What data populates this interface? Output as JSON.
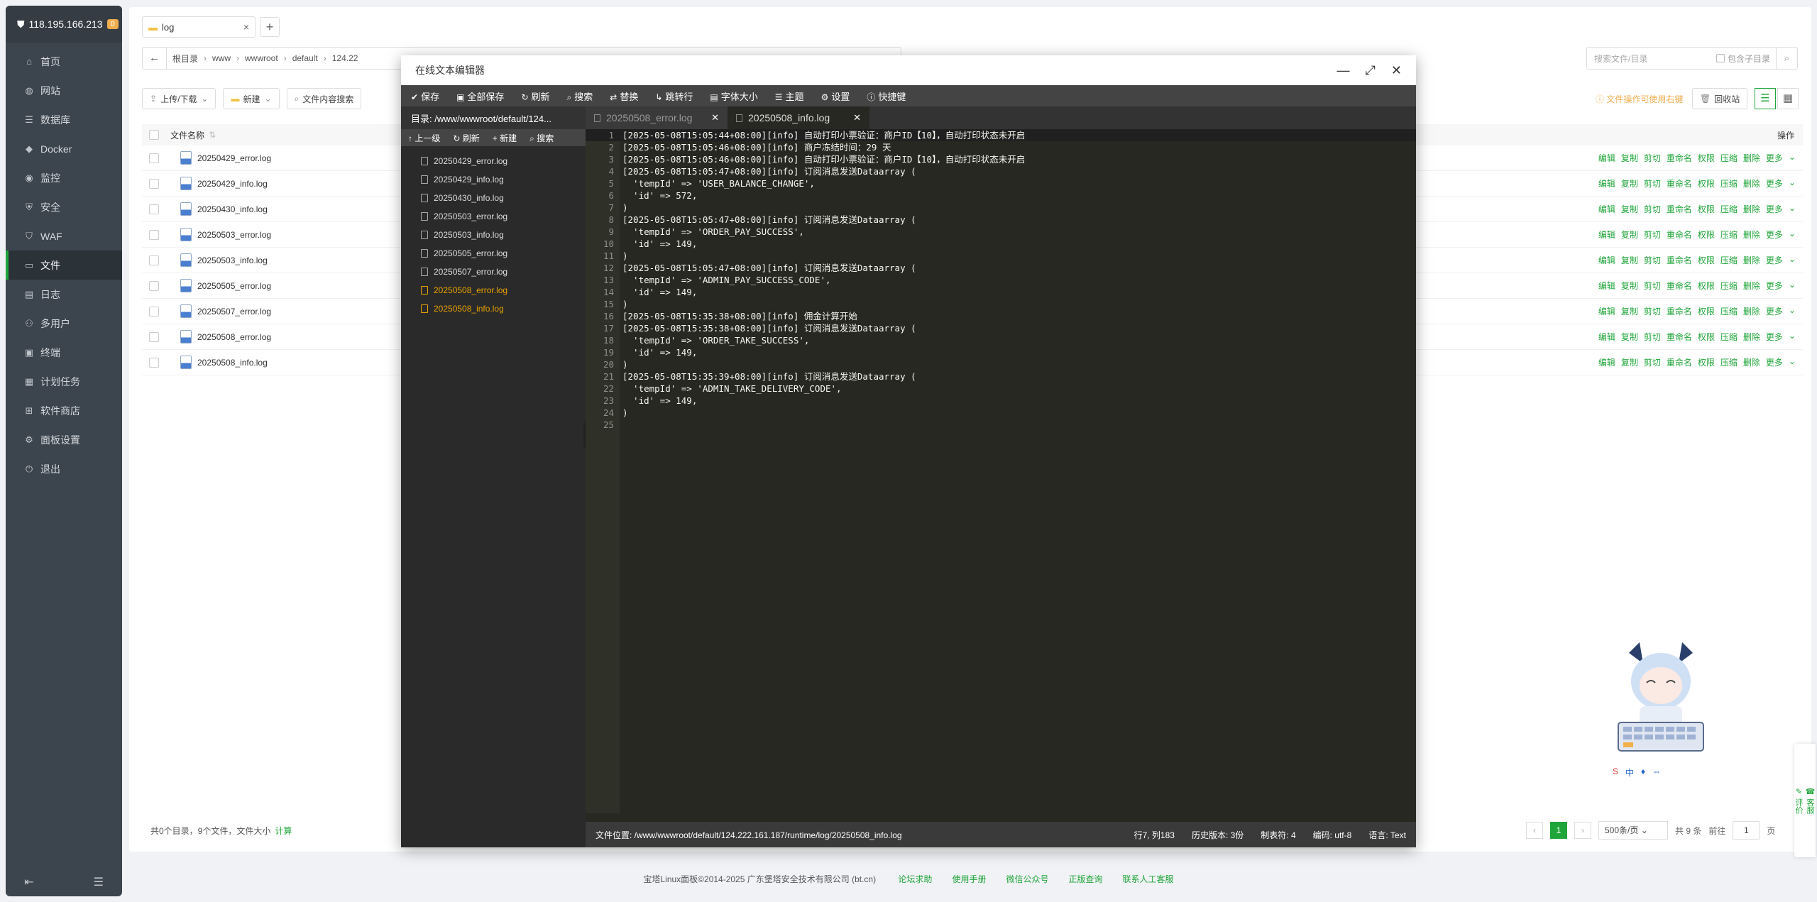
{
  "sidebar": {
    "ip": "118.195.166.213",
    "badge": "0",
    "items": [
      {
        "label": "首页",
        "icon": "home-icon"
      },
      {
        "label": "网站",
        "icon": "globe-icon"
      },
      {
        "label": "数据库",
        "icon": "database-icon"
      },
      {
        "label": "Docker",
        "icon": "docker-icon"
      },
      {
        "label": "监控",
        "icon": "monitor-icon"
      },
      {
        "label": "安全",
        "icon": "shield-icon"
      },
      {
        "label": "WAF",
        "icon": "waf-icon"
      },
      {
        "label": "文件",
        "icon": "folder-icon"
      },
      {
        "label": "日志",
        "icon": "log-icon"
      },
      {
        "label": "多用户",
        "icon": "users-icon"
      },
      {
        "label": "终端",
        "icon": "terminal-icon"
      },
      {
        "label": "计划任务",
        "icon": "calendar-icon"
      },
      {
        "label": "软件商店",
        "icon": "store-icon"
      },
      {
        "label": "面板设置",
        "icon": "gear-icon"
      },
      {
        "label": "退出",
        "icon": "logout-icon"
      }
    ],
    "active": "文件"
  },
  "files": {
    "tab_label": "log",
    "breadcrumb": [
      "根目录",
      "www",
      "wwwroot",
      "default",
      "124.22"
    ],
    "search_placeholder": "搜索文件/目录",
    "include_sub": "包含子目录",
    "toolbar": {
      "upload": "上传/下载",
      "new": "新建",
      "search_content": "文件内容搜索"
    },
    "warning": "文件操作可使用右键",
    "recycle": "回收站",
    "header_name": "文件名称",
    "header_ops": "操作",
    "rows": [
      "20250429_error.log",
      "20250429_info.log",
      "20250430_info.log",
      "20250503_error.log",
      "20250503_info.log",
      "20250505_error.log",
      "20250507_error.log",
      "20250508_error.log",
      "20250508_info.log"
    ],
    "ops": [
      "编辑",
      "复制",
      "剪切",
      "重命名",
      "权限",
      "压缩",
      "删除",
      "更多"
    ],
    "summary": "共0个目录，9个文件，文件大小",
    "calc": "计算",
    "pager": {
      "current": "1",
      "per_page": "500条/页",
      "total": "共 9 条",
      "goto": "前往",
      "page_input": "1",
      "page_suffix": "页"
    }
  },
  "editor": {
    "title": "在线文本编辑器",
    "toolbar": [
      "保存",
      "全部保存",
      "刷新",
      "搜索",
      "替换",
      "跳转行",
      "字体大小",
      "主题",
      "设置",
      "快捷键"
    ],
    "dir_path": "目录: /www/wwwroot/default/124...",
    "side_tools": [
      "上一级",
      "刷新",
      "新建",
      "搜索"
    ],
    "side_files": [
      "20250429_error.log",
      "20250429_info.log",
      "20250430_info.log",
      "20250503_error.log",
      "20250503_info.log",
      "20250505_error.log",
      "20250507_error.log",
      "20250508_error.log",
      "20250508_info.log"
    ],
    "highlighted_files": [
      "20250508_error.log",
      "20250508_info.log"
    ],
    "tabs": [
      "20250508_error.log",
      "20250508_info.log"
    ],
    "active_tab": "20250508_info.log",
    "lines": [
      "[2025-05-08T15:05:44+08:00][info] 自动打印小票验证：商户ID【10】，自动打印状态未开启",
      "[2025-05-08T15:05:46+08:00][info] 商户冻结时间：29 天",
      "[2025-05-08T15:05:46+08:00][info] 自动打印小票验证：商户ID【10】，自动打印状态未开启",
      "[2025-05-08T15:05:47+08:00][info] 订阅消息发送Dataarray (",
      "  'tempId' => 'USER_BALANCE_CHANGE',",
      "  'id' => 572,",
      ")",
      "[2025-05-08T15:05:47+08:00][info] 订阅消息发送Dataarray (",
      "  'tempId' => 'ORDER_PAY_SUCCESS',",
      "  'id' => 149,",
      ")",
      "[2025-05-08T15:05:47+08:00][info] 订阅消息发送Dataarray (",
      "  'tempId' => 'ADMIN_PAY_SUCCESS_CODE',",
      "  'id' => 149,",
      ")",
      "[2025-05-08T15:35:38+08:00][info] 佣金计算开始",
      "[2025-05-08T15:35:38+08:00][info] 订阅消息发送Dataarray (",
      "  'tempId' => 'ORDER_TAKE_SUCCESS',",
      "  'id' => 149,",
      ")",
      "[2025-05-08T15:35:39+08:00][info] 订阅消息发送Dataarray (",
      "  'tempId' => 'ADMIN_TAKE_DELIVERY_CODE',",
      "  'id' => 149,",
      ")",
      ""
    ],
    "status": {
      "file_path": "文件位置: /www/wwwroot/default/124.222.161.187/runtime/log/20250508_info.log",
      "cursor": "行7, 列183",
      "history": "历史版本: 3份",
      "tab_size": "制表符: 4",
      "encoding": "编码: utf-8",
      "language": "语言: Text"
    }
  },
  "footer": {
    "copyright": "宝塔Linux面板©2014-2025 广东堡塔安全技术有限公司 (bt.cn)",
    "links": [
      "论坛求助",
      "使用手册",
      "微信公众号",
      "正版查询",
      "联系人工客服"
    ]
  },
  "fab": {
    "service": "客服",
    "review": "评价"
  },
  "colors": {
    "accent": "#20a53a",
    "sidebar_bg": "#3c444d",
    "editor_bg": "#272822",
    "highlight": "#e8a200"
  }
}
